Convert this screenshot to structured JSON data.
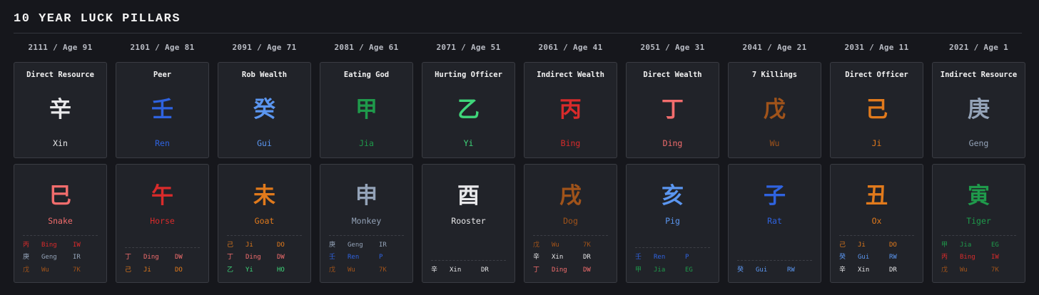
{
  "title": "10 YEAR LUCK PILLARS",
  "colors": {
    "xin": "#e8e8ea",
    "ren": "#2f63e0",
    "gui": "#5b96f0",
    "jia": "#1f9a4b",
    "yi": "#3fd67a",
    "bing": "#d92b2b",
    "ding": "#f26d6d",
    "wu": "#a0531a",
    "ji": "#e17a1c",
    "geng": "#94a3b8"
  },
  "pillars": [
    {
      "header": "2111 / Age 91",
      "god": "Direct Resource",
      "stem": {
        "char": "辛",
        "name": "Xin",
        "color": "#e8e8ea"
      },
      "branch": {
        "char": "巳",
        "name": "Snake",
        "color": "#f26d6d"
      },
      "hidden": [
        {
          "char": "丙",
          "name": "Bing",
          "tag": "IW",
          "color": "#d92b2b"
        },
        {
          "char": "庚",
          "name": "Geng",
          "tag": "IR",
          "color": "#94a3b8"
        },
        {
          "char": "戊",
          "name": "Wu",
          "tag": "7K",
          "color": "#a0531a"
        }
      ]
    },
    {
      "header": "2101 / Age 81",
      "god": "Peer",
      "stem": {
        "char": "壬",
        "name": "Ren",
        "color": "#2f63e0"
      },
      "branch": {
        "char": "午",
        "name": "Horse",
        "color": "#d92b2b"
      },
      "hidden": [
        {
          "char": "丁",
          "name": "Ding",
          "tag": "DW",
          "color": "#f26d6d"
        },
        {
          "char": "己",
          "name": "Ji",
          "tag": "DO",
          "color": "#e17a1c"
        }
      ]
    },
    {
      "header": "2091 / Age 71",
      "god": "Rob Wealth",
      "stem": {
        "char": "癸",
        "name": "Gui",
        "color": "#5b96f0"
      },
      "branch": {
        "char": "未",
        "name": "Goat",
        "color": "#e17a1c"
      },
      "hidden": [
        {
          "char": "己",
          "name": "Ji",
          "tag": "DO",
          "color": "#e17a1c"
        },
        {
          "char": "丁",
          "name": "Ding",
          "tag": "DW",
          "color": "#f26d6d"
        },
        {
          "char": "乙",
          "name": "Yi",
          "tag": "HO",
          "color": "#3fd67a"
        }
      ]
    },
    {
      "header": "2081 / Age 61",
      "god": "Eating God",
      "stem": {
        "char": "甲",
        "name": "Jia",
        "color": "#1f9a4b"
      },
      "branch": {
        "char": "申",
        "name": "Monkey",
        "color": "#94a3b8"
      },
      "hidden": [
        {
          "char": "庚",
          "name": "Geng",
          "tag": "IR",
          "color": "#94a3b8"
        },
        {
          "char": "壬",
          "name": "Ren",
          "tag": "P",
          "color": "#2f63e0"
        },
        {
          "char": "戊",
          "name": "Wu",
          "tag": "7K",
          "color": "#a0531a"
        }
      ]
    },
    {
      "header": "2071 / Age 51",
      "god": "Hurting Officer",
      "stem": {
        "char": "乙",
        "name": "Yi",
        "color": "#3fd67a"
      },
      "branch": {
        "char": "酉",
        "name": "Rooster",
        "color": "#e8e8ea"
      },
      "hidden": [
        {
          "char": "辛",
          "name": "Xin",
          "tag": "DR",
          "color": "#e8e8ea"
        }
      ]
    },
    {
      "header": "2061 / Age 41",
      "god": "Indirect Wealth",
      "stem": {
        "char": "丙",
        "name": "Bing",
        "color": "#d92b2b"
      },
      "branch": {
        "char": "戌",
        "name": "Dog",
        "color": "#a0531a"
      },
      "hidden": [
        {
          "char": "戊",
          "name": "Wu",
          "tag": "7K",
          "color": "#a0531a"
        },
        {
          "char": "辛",
          "name": "Xin",
          "tag": "DR",
          "color": "#e8e8ea"
        },
        {
          "char": "丁",
          "name": "Ding",
          "tag": "DW",
          "color": "#f26d6d"
        }
      ]
    },
    {
      "header": "2051 / Age 31",
      "god": "Direct Wealth",
      "stem": {
        "char": "丁",
        "name": "Ding",
        "color": "#f26d6d"
      },
      "branch": {
        "char": "亥",
        "name": "Pig",
        "color": "#5b96f0"
      },
      "hidden": [
        {
          "char": "壬",
          "name": "Ren",
          "tag": "P",
          "color": "#2f63e0"
        },
        {
          "char": "甲",
          "name": "Jia",
          "tag": "EG",
          "color": "#1f9a4b"
        }
      ]
    },
    {
      "header": "2041 / Age 21",
      "god": "7 Killings",
      "stem": {
        "char": "戊",
        "name": "Wu",
        "color": "#a0531a"
      },
      "branch": {
        "char": "子",
        "name": "Rat",
        "color": "#2f63e0"
      },
      "hidden": [
        {
          "char": "癸",
          "name": "Gui",
          "tag": "RW",
          "color": "#5b96f0"
        }
      ]
    },
    {
      "header": "2031 / Age 11",
      "god": "Direct Officer",
      "stem": {
        "char": "己",
        "name": "Ji",
        "color": "#e17a1c"
      },
      "branch": {
        "char": "丑",
        "name": "Ox",
        "color": "#e17a1c"
      },
      "hidden": [
        {
          "char": "己",
          "name": "Ji",
          "tag": "DO",
          "color": "#e17a1c"
        },
        {
          "char": "癸",
          "name": "Gui",
          "tag": "RW",
          "color": "#5b96f0"
        },
        {
          "char": "辛",
          "name": "Xin",
          "tag": "DR",
          "color": "#e8e8ea"
        }
      ]
    },
    {
      "header": "2021 / Age 1",
      "god": "Indirect Resource",
      "stem": {
        "char": "庚",
        "name": "Geng",
        "color": "#94a3b8"
      },
      "branch": {
        "char": "寅",
        "name": "Tiger",
        "color": "#1f9a4b"
      },
      "hidden": [
        {
          "char": "甲",
          "name": "Jia",
          "tag": "EG",
          "color": "#1f9a4b"
        },
        {
          "char": "丙",
          "name": "Bing",
          "tag": "IW",
          "color": "#d92b2b"
        },
        {
          "char": "戊",
          "name": "Wu",
          "tag": "7K",
          "color": "#a0531a"
        }
      ]
    }
  ]
}
